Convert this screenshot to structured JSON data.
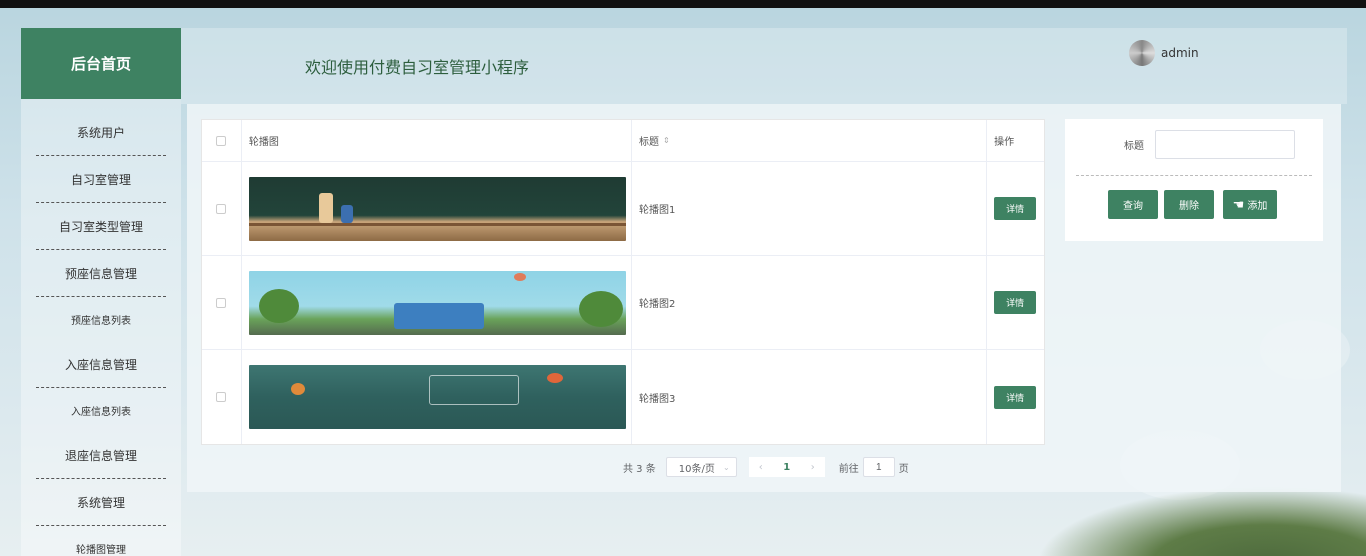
{
  "sidebar": {
    "brand": "后台首页",
    "items": [
      {
        "label": "系统用户"
      },
      {
        "label": "自习室管理"
      },
      {
        "label": "自习室类型管理"
      },
      {
        "label": "预座信息管理"
      },
      {
        "label": "预座信息列表"
      },
      {
        "label": "入座信息管理"
      },
      {
        "label": "入座信息列表"
      },
      {
        "label": "退座信息管理"
      },
      {
        "label": "系统管理"
      },
      {
        "label": "轮播图管理"
      }
    ]
  },
  "header": {
    "welcome": "欢迎使用付费自习室管理小程序",
    "username": "admin"
  },
  "table": {
    "columns": {
      "image": "轮播图",
      "title": "标题",
      "actions": "操作"
    },
    "rows": [
      {
        "title": "轮播图1",
        "action": "详情"
      },
      {
        "title": "轮播图2",
        "action": "详情"
      },
      {
        "title": "轮播图3",
        "action": "详情"
      }
    ]
  },
  "pagination": {
    "total": "共 3 条",
    "page_size": "10条/页",
    "current_page": "1",
    "goto_label": "前往",
    "goto_value": "1",
    "page_suffix": "页"
  },
  "search": {
    "label": "标题",
    "query_label": "查询",
    "delete_label": "删除",
    "add_label": "添加"
  },
  "colors": {
    "accent": "#3e8262"
  },
  "icons": [
    "avatar-icon",
    "sort-icon",
    "chevron-left-icon",
    "chevron-right-icon",
    "chevron-down-icon",
    "hand-cursor-icon"
  ]
}
